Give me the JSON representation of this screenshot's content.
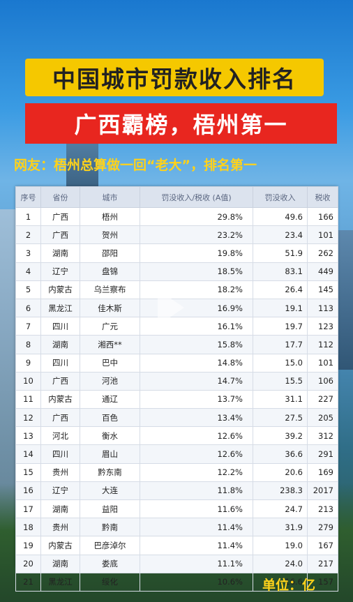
{
  "title": "中国城市罚款收入排名",
  "subtitle": "广西霸榜，梧州第一",
  "netizen_comment": "网友：梧州总算做一回“老大”，排名第一",
  "unit": "单位：亿",
  "table": {
    "headers": [
      "序号",
      "省份",
      "城市",
      "罚没收入/税收 (A值)",
      "罚没收入",
      "税收"
    ],
    "rows": [
      {
        "rank": "1",
        "province": "广西",
        "city": "梧州",
        "ratio": "29.8%",
        "fines": "49.6",
        "tax": "166"
      },
      {
        "rank": "2",
        "province": "广西",
        "city": "贺州",
        "ratio": "23.2%",
        "fines": "23.4",
        "tax": "101"
      },
      {
        "rank": "3",
        "province": "湖南",
        "city": "邵阳",
        "ratio": "19.8%",
        "fines": "51.9",
        "tax": "262"
      },
      {
        "rank": "4",
        "province": "辽宁",
        "city": "盘锦",
        "ratio": "18.5%",
        "fines": "83.1",
        "tax": "449"
      },
      {
        "rank": "5",
        "province": "内蒙古",
        "city": "乌兰察布",
        "ratio": "18.2%",
        "fines": "26.4",
        "tax": "145"
      },
      {
        "rank": "6",
        "province": "黑龙江",
        "city": "佳木斯",
        "ratio": "16.9%",
        "fines": "19.1",
        "tax": "113"
      },
      {
        "rank": "7",
        "province": "四川",
        "city": "广元",
        "ratio": "16.1%",
        "fines": "19.7",
        "tax": "123"
      },
      {
        "rank": "8",
        "province": "湖南",
        "city": "湘西**",
        "ratio": "15.8%",
        "fines": "17.7",
        "tax": "112"
      },
      {
        "rank": "9",
        "province": "四川",
        "city": "巴中",
        "ratio": "14.8%",
        "fines": "15.0",
        "tax": "101"
      },
      {
        "rank": "10",
        "province": "广西",
        "city": "河池",
        "ratio": "14.7%",
        "fines": "15.5",
        "tax": "106"
      },
      {
        "rank": "11",
        "province": "内蒙古",
        "city": "通辽",
        "ratio": "13.7%",
        "fines": "31.1",
        "tax": "227"
      },
      {
        "rank": "12",
        "province": "广西",
        "city": "百色",
        "ratio": "13.4%",
        "fines": "27.5",
        "tax": "205"
      },
      {
        "rank": "13",
        "province": "河北",
        "city": "衡水",
        "ratio": "12.6%",
        "fines": "39.2",
        "tax": "312"
      },
      {
        "rank": "14",
        "province": "四川",
        "city": "眉山",
        "ratio": "12.6%",
        "fines": "36.6",
        "tax": "291"
      },
      {
        "rank": "15",
        "province": "贵州",
        "city": "黔东南",
        "ratio": "12.2%",
        "fines": "20.6",
        "tax": "169"
      },
      {
        "rank": "16",
        "province": "辽宁",
        "city": "大连",
        "ratio": "11.8%",
        "fines": "238.3",
        "tax": "2017"
      },
      {
        "rank": "17",
        "province": "湖南",
        "city": "益阳",
        "ratio": "11.6%",
        "fines": "24.7",
        "tax": "213"
      },
      {
        "rank": "18",
        "province": "贵州",
        "city": "黔南",
        "ratio": "11.4%",
        "fines": "31.9",
        "tax": "279"
      },
      {
        "rank": "19",
        "province": "内蒙古",
        "city": "巴彦淖尔",
        "ratio": "11.4%",
        "fines": "19.0",
        "tax": "167"
      },
      {
        "rank": "20",
        "province": "湖南",
        "city": "娄底",
        "ratio": "11.1%",
        "fines": "24.0",
        "tax": "217"
      },
      {
        "rank": "21",
        "province": "黑龙江",
        "city": "绥化",
        "ratio": "10.6%",
        "fines": "16.6",
        "tax": "157"
      }
    ]
  }
}
